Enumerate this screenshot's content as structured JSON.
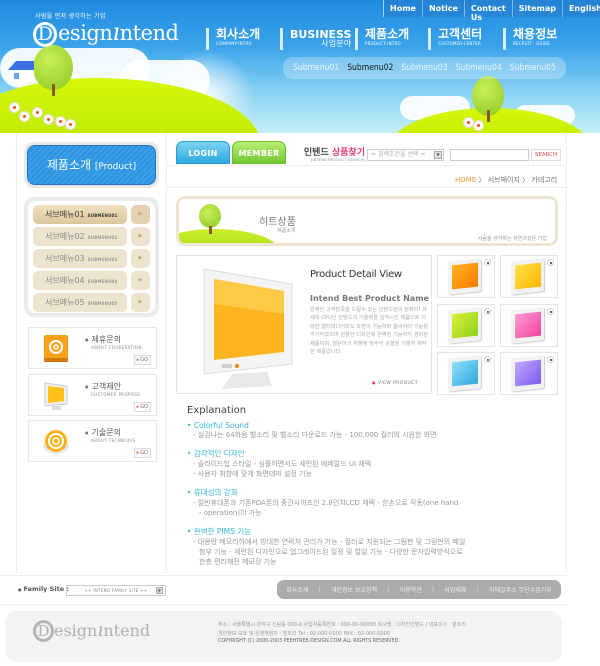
{
  "header": {
    "logo_tagline": "사람을 먼저 생각하는 기업",
    "logo_d": "D",
    "logo_text": "esign",
    "logo_i": "ı",
    "logo_text2": "ntend",
    "top_links": [
      "Home",
      "Notice",
      "Contact Us",
      "Sitemap",
      "English"
    ],
    "gnb": [
      {
        "ko": "회사소개",
        "en": "COMPANY-INTRO"
      },
      {
        "ko": "BUSINESS",
        "en": "사업분야"
      },
      {
        "ko": "제품소개",
        "en": "PRODUCT-INTRO"
      },
      {
        "ko": "고객센터",
        "en": "CUSTOMER-CENTER"
      },
      {
        "ko": "채용정보",
        "en": "RECRUIT · GUIDE"
      }
    ],
    "submenu": [
      "Submenu01",
      "Submenu02",
      "Submenu03",
      "Submenu04",
      "Submenu05"
    ],
    "submenu_active": "Submenu02"
  },
  "sidebar": {
    "title_ko": "제품소개",
    "title_en": "[Product]",
    "items": [
      {
        "ko": "서브메뉴01",
        "en": "SUBMENU01"
      },
      {
        "ko": "서브메뉴02",
        "en": "SUBMENU02"
      },
      {
        "ko": "서브메뉴03",
        "en": "SUBMENU03"
      },
      {
        "ko": "서브메뉴04",
        "en": "SUBMENU04"
      },
      {
        "ko": "서브메뉴05",
        "en": "SUBMENU05"
      }
    ],
    "arrow": "▶",
    "quick": [
      {
        "title": "제휴문의",
        "sub": "ABOUT COOPERATION",
        "go": "GO",
        "icon": "address-book-icon"
      },
      {
        "title": "고객제안",
        "sub": "CUSTOMER PROPOSE",
        "go": "GO",
        "icon": "monitor-icon"
      },
      {
        "title": "기술문의",
        "sub": "ABOUT TECHNIQUE",
        "go": "GO",
        "icon": "at-sign-icon"
      }
    ]
  },
  "topbar": {
    "login": "LOGIN",
    "member": "MEMBER",
    "search_title_a": "인텐드 ",
    "search_title_b": "상품찾기",
    "search_title_en": "[INTEND PRODUCT SEARCH]",
    "search_select": "= 검색조건을 선택 =",
    "search_value": "",
    "search_button": "SEARCH",
    "breadcrumb": [
      "HOME",
      "서브페이지",
      "카테고리"
    ],
    "crumb_sep": "〉"
  },
  "banner": {
    "title": "히트상품",
    "subtitle": "제품소개",
    "tagline": "사람을 생각하는 자연과같은 기업"
  },
  "product": {
    "title": "Product Detail View",
    "name": "Intend Best Product Name",
    "description": "완벽한 고객만족을 드릴수 있는 인텐드만의 컴퓨터! 차세대 CPU인 인텐드의 기술력을 집약시킨 제품으로 어떠한 멀티미디어와도 호환이 가능하며 홈씨어터 기능을 추가하였으며 심플한 디자인에 완벽한 기능까지 겸비한 제품이며, 젊은이의 취향에 맞추어 심혈을 기울여 제작한 제품입니다.",
    "view_button": "VIEW PRODUCT",
    "thumbnails": [
      {
        "color": "orange",
        "c1": "#ffb21e",
        "c2": "#ff7a00"
      },
      {
        "color": "yellow",
        "c1": "#ffe24a",
        "c2": "#ffb400"
      },
      {
        "color": "green",
        "c1": "#d8f03a",
        "c2": "#8fd11a"
      },
      {
        "color": "pink",
        "c1": "#ff9ad6",
        "c2": "#f0469e"
      },
      {
        "color": "blue",
        "c1": "#8fe0f8",
        "c2": "#2fa8e0"
      },
      {
        "color": "purple",
        "c1": "#c0a8ff",
        "c2": "#7a5cf0"
      }
    ]
  },
  "explanation": {
    "heading": "Explanation",
    "sections": [
      {
        "title": "Colorful Sound",
        "lines": [
          "- 실감나는 64화음 벨소리 및 벨소리 다운로드 가능  - 100,000 컬러의 시원한 화면"
        ]
      },
      {
        "title": "감각적인 디자인",
        "lines": [
          "- 슬라이드업 스타일  - 심플하면서도 세련된 에메랄드 UI 채택",
          "- 사용자 취향에 맞게 화면테마 설정 기능"
        ]
      },
      {
        "title": "휴대성의 강화",
        "lines": [
          "- 일반휴대폰과 기존PDA폰의 중간사이즈인 2.8인치LCD 채택  - 한손으로 작동(one hand",
          "  - operation)이 가능"
        ]
      },
      {
        "title": "완벽한 PIMS 기능",
        "lines": [
          "- 대용량 메모리하에서 방대한 연락처 관리가 가능  - 컬러로 지원되는 그림판 및 그림판의 메일",
          "  첨부 기능  - 세련된 디자인으로 업그레이드된 일정 및 할일 기능  - 다양한 문자입력방식으로",
          "  한층 편리해진 메모장 기능"
        ]
      }
    ]
  },
  "footer": {
    "family_label": "Family Site :",
    "family_select": "++ INTEND FAMILY SITE ++",
    "links": [
      "회사소개",
      "개인정보 보호정책",
      "이용약관",
      "사업제휴",
      "이메일주소 무단수집거부"
    ],
    "info_line1": "주소 : 서울특별시 관악구 신림동 000-0  사업자등록번호 : 000-00-00000 회사명 : 디자인인텐드  / 대표이사 : 핀트리",
    "info_line2": "개인정보 보호 및 운영책임자 :  핀트리   Tel : 02-000-0000  FAX : 02-000-0000",
    "copyright": "COPYRIGHT (C) 2000-2003 PEEHTREE-DESIGN.COM  ALL RIGHTS RESERVED.",
    "logo_d": "D",
    "logo_text": "esign",
    "logo_i": "ı",
    "logo_text2": "ntend"
  },
  "colors": {
    "sky_blue": "#2d96e3",
    "tab_login": "#3fb4e6",
    "tab_member": "#8fd64a",
    "accent_pink": "#e43a7a",
    "accent_orange": "#f09430",
    "explain_cyan": "#35b5d8"
  }
}
